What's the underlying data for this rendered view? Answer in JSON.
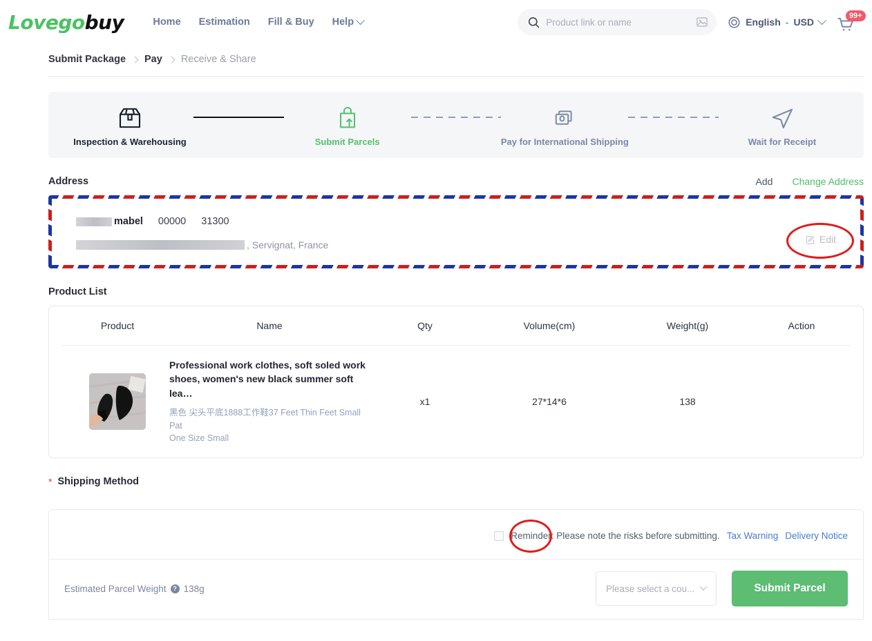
{
  "brand": {
    "logo_part1": "Lovego",
    "logo_part2": "buy",
    "green": "#4dc163"
  },
  "header": {
    "nav": [
      {
        "label": "Home",
        "icon": null
      },
      {
        "label": "Estimation",
        "icon": null
      },
      {
        "label": "Fill & Buy",
        "icon": null
      },
      {
        "label": "Help",
        "icon": "chevron-down-icon"
      }
    ],
    "search": {
      "placeholder": "Product link or name",
      "value": "",
      "search_icon": "search-icon",
      "image_search_icon": "image-search-icon"
    },
    "language": {
      "globe_icon": "globe-icon",
      "language": "English",
      "separator": "-",
      "currency": "USD",
      "caret_icon": "chevron-down-icon"
    },
    "cart": {
      "icon": "cart-icon",
      "badge": "99+"
    }
  },
  "breadcrumb": {
    "items": [
      {
        "label": "Submit Package",
        "active": true
      },
      {
        "label": "Pay",
        "active": true
      },
      {
        "label": "Receive & Share",
        "active": false
      }
    ]
  },
  "stepper": {
    "steps": [
      {
        "label": "Inspection & Warehousing",
        "state": "done",
        "icon": "box-icon"
      },
      {
        "label": "Submit Parcels",
        "state": "current",
        "icon": "bag-upload-icon"
      },
      {
        "label": "Pay for International Shipping",
        "state": "todo",
        "icon": "payment-cards-icon"
      },
      {
        "label": "Wait for Receipt",
        "state": "todo",
        "icon": "send-arrow-icon"
      }
    ],
    "connectors": [
      "solid",
      "dashed",
      "dashed"
    ]
  },
  "address": {
    "section_title": "Address",
    "add_label": "Add",
    "change_label": "Change Address",
    "recipient_name": "mabel",
    "phone": "00000",
    "postal_code": "31300",
    "street_redacted": true,
    "city": "Servignat",
    "country": "France",
    "address_tail": ", Servignat, France",
    "edit_label": "Edit",
    "edit_icon": "edit-pencil-icon"
  },
  "product_list": {
    "section_title": "Product List",
    "columns": [
      "Product",
      "Name",
      "Qty",
      "Volume(cm)",
      "Weight(g)",
      "Action"
    ],
    "rows": [
      {
        "thumbnail": "black-pointed-flat-shoes-photo",
        "name": "Professional work clothes, soft soled work shoes, women's new black summer soft lea…",
        "sku_line1": "黑色 尖头平底1888工作鞋37 Feet Thin Feet Small Pat",
        "sku_line2": "One Size Small",
        "qty": "x1",
        "volume": "27*14*6",
        "weight": "138",
        "action": ""
      }
    ]
  },
  "shipping_method": {
    "required_marker": "*",
    "title": "Shipping Method"
  },
  "bottom": {
    "checkbox_checked": false,
    "reminder_text": "Reminder: Please note the risks before submitting.",
    "tax_warning_label": "Tax Warning",
    "delivery_notice_label": "Delivery Notice",
    "estimated_weight_label": "Estimated Parcel Weight",
    "help_icon": "question-mark-icon",
    "estimated_weight_value": "138g",
    "country_select_placeholder": "Please select a cou...",
    "submit_label": "Submit Parcel",
    "submit_color": "#5cbd73"
  },
  "annotations": [
    {
      "name": "edit-button-highlight",
      "shape": "ellipse",
      "color": "#e01b1b"
    },
    {
      "name": "reminder-checkbox-highlight",
      "shape": "ellipse",
      "color": "#e01b1b"
    }
  ]
}
